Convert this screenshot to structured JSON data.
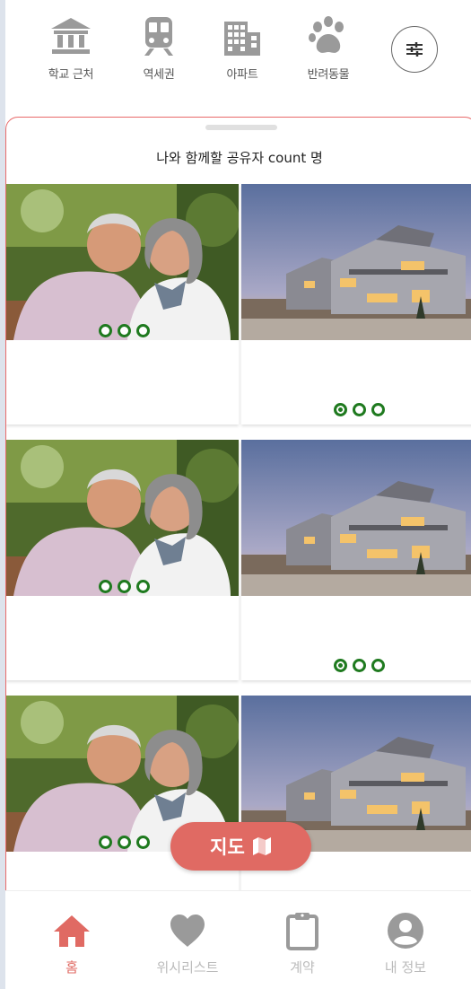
{
  "categories": [
    {
      "label": "학교 근처",
      "icon": "school-building-icon"
    },
    {
      "label": "역세권",
      "icon": "subway-train-icon"
    },
    {
      "label": "아파트",
      "icon": "apartment-building-icon"
    },
    {
      "label": "반려동물",
      "icon": "paw-icon"
    }
  ],
  "filter": {
    "icon": "filter-sliders-icon"
  },
  "sheet": {
    "title": "나와 함께할 공유자 count 명"
  },
  "listings": [
    {
      "left": {
        "dots": 3
      },
      "right": {
        "dots": 3
      }
    },
    {
      "left": {
        "dots": 3
      },
      "right": {
        "dots": 3
      }
    },
    {
      "left": {
        "dots": 3
      },
      "right": {
        "dots": 3
      }
    }
  ],
  "map_button": {
    "label": "지도",
    "icon": "map-icon"
  },
  "bottom_nav": [
    {
      "label": "홈",
      "icon": "home-icon",
      "active": true
    },
    {
      "label": "위시리스트",
      "icon": "heart-icon",
      "active": false
    },
    {
      "label": "계약",
      "icon": "clipboard-icon",
      "active": false
    },
    {
      "label": "내 정보",
      "icon": "user-avatar-icon",
      "active": false
    }
  ],
  "colors": {
    "accent": "#e06a63",
    "dot": "#1f7a1f",
    "icon_gray": "#9a9a9a",
    "nav_gray": "#bbbbbb"
  }
}
